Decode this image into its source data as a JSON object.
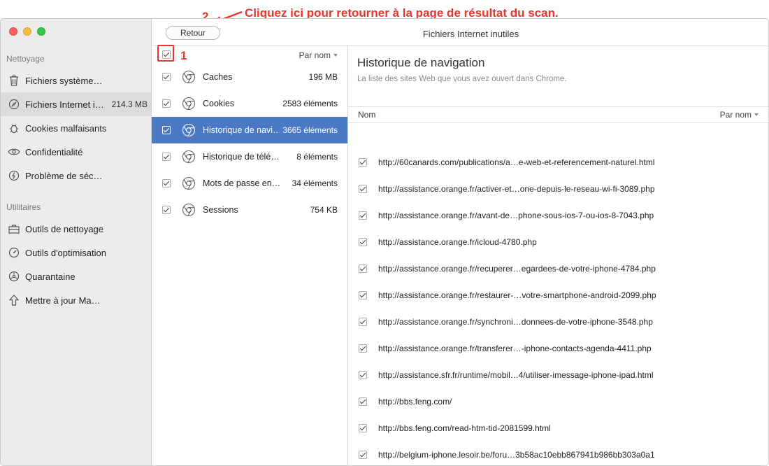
{
  "annotation": {
    "step1": "1",
    "step2": "2",
    "instruction": "Cliquez ici pour retourner à la page de résultat du scan."
  },
  "window": {
    "title": "Fichiers Internet inutiles",
    "back_label": "Retour"
  },
  "sidebar": {
    "section1": "Nettoyage",
    "section2": "Utilitaires",
    "items": [
      {
        "label": "Fichiers système…",
        "icon": "trash-icon",
        "size": ""
      },
      {
        "label": "Fichiers Internet i…",
        "icon": "compass-icon",
        "size": "214.3 MB"
      },
      {
        "label": "Cookies malfaisants",
        "icon": "bug-icon",
        "size": ""
      },
      {
        "label": "Confidentialité",
        "icon": "eye-icon",
        "size": ""
      },
      {
        "label": "Problème de séc…",
        "icon": "shield-icon",
        "size": ""
      },
      {
        "label": "Outils de nettoyage",
        "icon": "toolbox-icon",
        "size": ""
      },
      {
        "label": "Outils d'optimisation",
        "icon": "gauge-icon",
        "size": ""
      },
      {
        "label": "Quarantaine",
        "icon": "biohazard-icon",
        "size": ""
      },
      {
        "label": "Mettre à jour Ma…",
        "icon": "upload-arrow-icon",
        "size": ""
      }
    ]
  },
  "middle": {
    "sort_label": "Par nom",
    "rows": [
      {
        "name": "Caches",
        "value": "196 MB"
      },
      {
        "name": "Cookies",
        "value": "2583 éléments"
      },
      {
        "name": "Historique de navi…",
        "value": "3665 éléments"
      },
      {
        "name": "Historique de télé…",
        "value": "8 éléments"
      },
      {
        "name": "Mots de passe en…",
        "value": "34 éléments"
      },
      {
        "name": "Sessions",
        "value": "754 KB"
      }
    ]
  },
  "detail": {
    "title": "Historique de navigation",
    "subtitle": "La liste des sites Web que vous avez ouvert dans Chrome.",
    "col_name": "Nom",
    "sort_label": "Par nom",
    "urls": [
      "http://60canards.com/publications/a…e-web-et-referencement-naturel.html",
      "http://assistance.orange.fr/activer-et…one-depuis-le-reseau-wi-fi-3089.php",
      "http://assistance.orange.fr/avant-de…phone-sous-ios-7-ou-ios-8-7043.php",
      "http://assistance.orange.fr/icloud-4780.php",
      "http://assistance.orange.fr/recuperer…egardees-de-votre-iphone-4784.php",
      "http://assistance.orange.fr/restaurer-…votre-smartphone-android-2099.php",
      "http://assistance.orange.fr/synchroni…donnees-de-votre-iphone-3548.php",
      "http://assistance.orange.fr/transferer…-iphone-contacts-agenda-4411.php",
      "http://assistance.sfr.fr/runtime/mobil…4/utiliser-imessage-iphone-ipad.html",
      "http://bbs.feng.com/",
      "http://bbs.feng.com/read-htm-tid-2081599.html",
      "http://belgium-iphone.lesoir.be/foru…3b58ac10ebb867941b986bb303a0a1"
    ]
  },
  "colors": {
    "annotation": "#e8362a",
    "selection": "#4a78c2",
    "sidebar_bg": "#ececec"
  }
}
